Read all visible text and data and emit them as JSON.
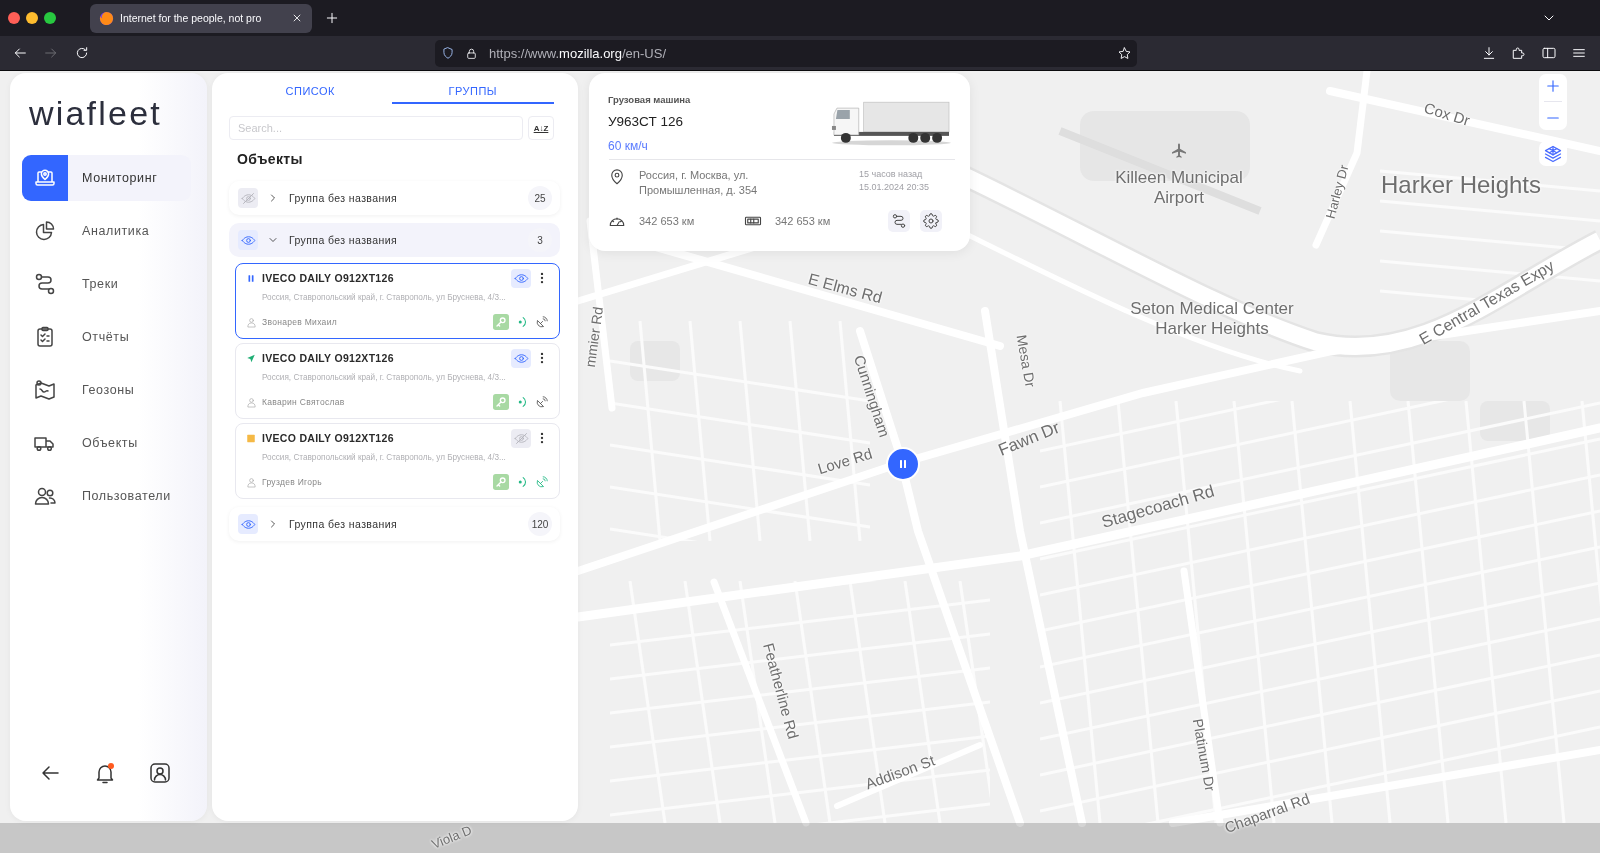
{
  "browser": {
    "tab_title": "Internet for the people, not pro",
    "url": "https://www.**mozilla.org**/en-US/",
    "forward_disabled": true
  },
  "sidebar": {
    "logo": "wiafleet",
    "nav": [
      {
        "label": "Мониторинг",
        "selected": true
      },
      {
        "label": "Аналитика",
        "selected": false
      },
      {
        "label": "Треки",
        "selected": false
      },
      {
        "label": "Отчёты",
        "selected": false
      },
      {
        "label": "Геозоны",
        "selected": false
      },
      {
        "label": "Объекты",
        "selected": false
      },
      {
        "label": "Пользователи",
        "selected": false
      }
    ],
    "notifications_unread": true
  },
  "list_panel": {
    "tabs": [
      {
        "label": "СПИСОК",
        "selected": false
      },
      {
        "label": "ГРУППЫ",
        "selected": true
      }
    ],
    "search": {
      "placeholder": "Search..."
    },
    "sort_button": "A↓Z",
    "heading": "Объекты",
    "groups": [
      {
        "name": "Группа без названия",
        "count": "25",
        "visible": false,
        "expanded": false
      },
      {
        "name": "Группа без названия",
        "count": "3",
        "visible": true,
        "expanded": true,
        "objects": [
          {
            "kind": "paused",
            "title": "IVECO DAILY O912XT126",
            "address": "Россия, Ставропольский край, г. Ставрополь, ул Бруснева, 4/3...",
            "driver": "Звонарев Михаил",
            "visible": true,
            "selected": true,
            "satellite_active": false
          },
          {
            "kind": "moving",
            "title": "IVECO DAILY O912XT126",
            "address": "Россия, Ставропольский край, г. Ставрополь, ул Бруснева, 4/3...",
            "driver": "Каварин Святослав",
            "visible": true,
            "selected": false,
            "satellite_active": false
          },
          {
            "kind": "stopped",
            "title": "IVECO DAILY O912XT126",
            "address": "Россия, Ставропольский край, г. Ставрополь, ул Бруснева, 4/3...",
            "driver": "Груздев Игорь",
            "visible": false,
            "selected": false,
            "satellite_active": true
          }
        ]
      },
      {
        "name": "Группа без названия",
        "count": "120",
        "visible": true,
        "expanded": false
      }
    ]
  },
  "vehicle_card": {
    "type": "Грузовая машина",
    "plate": "У963СТ 126",
    "speed": "60 км/ч",
    "address": "Россия, г. Москва, ул. Промышленная, д. 354",
    "time_ago": "15 часов назад",
    "timestamp": "15.01.2024 20:35",
    "odometer": "342 653 км",
    "counter": "342 653 км"
  },
  "map": {
    "labels": [
      "Cox Dr",
      "Killeen Municipal Airport",
      "Harker Heights",
      "Harley Dr",
      "E Elms Rd",
      "Seton Medical Center Harker Heights",
      "E Central Texas Expy",
      "mmier Rd",
      "Mesa Dr",
      "Cunningham",
      "Fawn Dr",
      "Love Rd",
      "Stagecoach Rd",
      "Featherline Rd",
      "Platinum Dr",
      "Addison St",
      "Chaparral Rd",
      "Viola D"
    ],
    "marker": {
      "kind": "paused"
    }
  }
}
